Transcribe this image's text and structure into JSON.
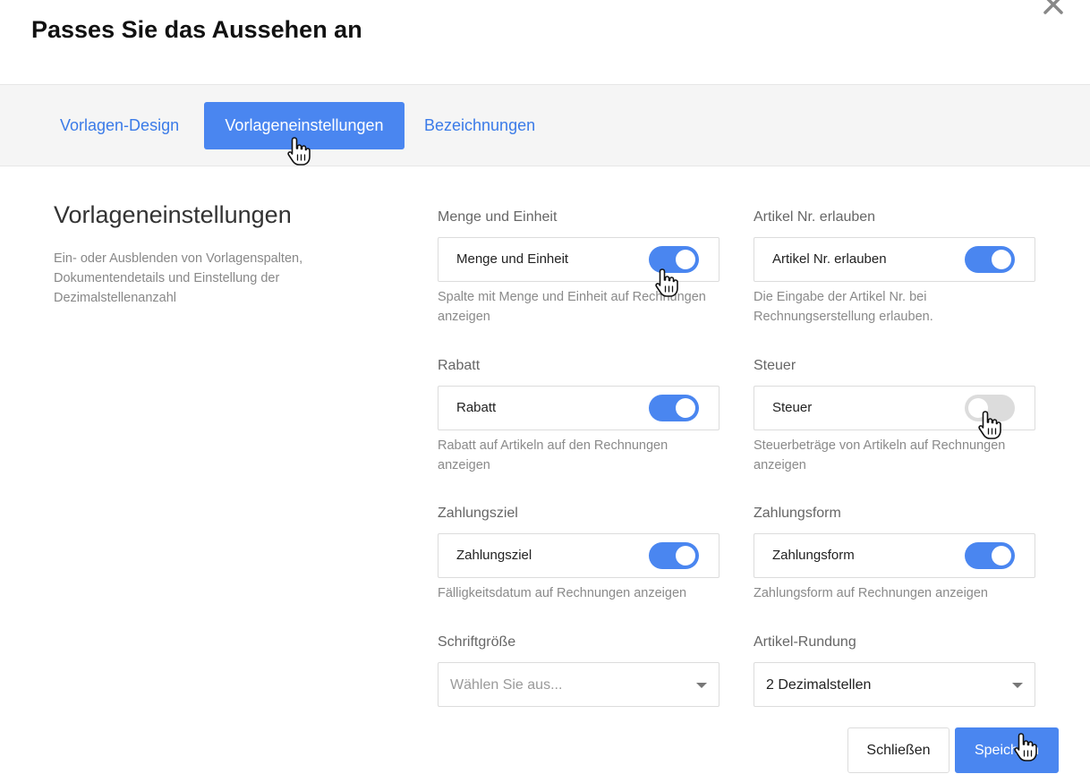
{
  "header": {
    "title": "Passes Sie das Aussehen an",
    "close_icon": "close-icon"
  },
  "tabs": [
    {
      "label": "Vorlagen-Design",
      "active": false
    },
    {
      "label": "Vorlageneinstellungen",
      "active": true
    },
    {
      "label": "Bezeichnungen",
      "active": false
    }
  ],
  "section": {
    "title": "Vorlageneinstellungen",
    "description": "Ein- oder Ausblenden von Vorlagenspalten, Dokumentendetails und Einstellung der Dezimalstellenanzahl"
  },
  "settings": {
    "quantity": {
      "label": "Menge und Einheit",
      "toggle_label": "Menge und Einheit",
      "enabled": true,
      "help": "Spalte mit Menge und Einheit auf Rechnungen anzeigen"
    },
    "article_no": {
      "label": "Artikel Nr. erlauben",
      "toggle_label": "Artikel Nr. erlauben",
      "enabled": true,
      "help": "Die Eingabe der Artikel Nr. bei Rechnungserstellung erlauben."
    },
    "discount": {
      "label": "Rabatt",
      "toggle_label": "Rabatt",
      "enabled": true,
      "help": "Rabatt auf Artikeln auf den Rechnungen anzeigen"
    },
    "tax": {
      "label": "Steuer",
      "toggle_label": "Steuer",
      "enabled": false,
      "help": "Steuerbeträge von Artikeln auf Rechnungen anzeigen"
    },
    "payment_term": {
      "label": "Zahlungsziel",
      "toggle_label": "Zahlungsziel",
      "enabled": true,
      "help": "Fälligkeitsdatum auf Rechnungen anzeigen"
    },
    "payment_method": {
      "label": "Zahlungsform",
      "toggle_label": "Zahlungsform",
      "enabled": true,
      "help": "Zahlungsform auf Rechnungen anzeigen"
    },
    "font_size": {
      "label": "Schriftgröße",
      "placeholder": "Wählen Sie aus..."
    },
    "rounding": {
      "label": "Artikel-Rundung",
      "value": "2 Dezimalstellen"
    }
  },
  "footer": {
    "close_label": "Schließen",
    "save_label": "Speichern"
  },
  "colors": {
    "accent": "#4a86f0",
    "tab_text": "#3b7be8",
    "toggle_off": "#dcdcdc"
  }
}
